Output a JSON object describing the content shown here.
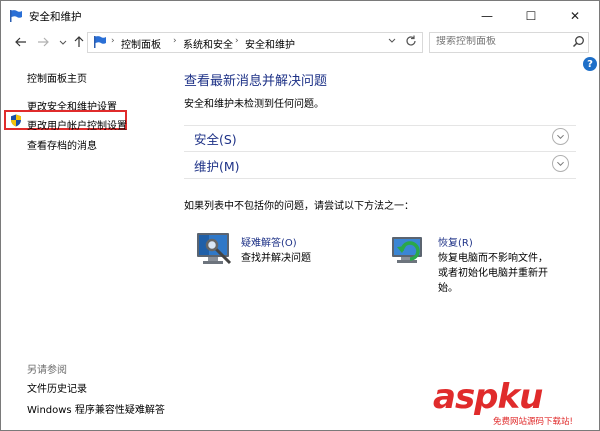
{
  "window": {
    "title": "安全和维护",
    "controls": {
      "minimize": "—",
      "maximize": "☐",
      "close": "✕"
    }
  },
  "address_bar": {
    "breadcrumbs": [
      "控制面板",
      "系统和安全",
      "安全和维护"
    ],
    "separator": "›"
  },
  "search": {
    "placeholder": "搜索控制面板"
  },
  "sidebar": {
    "home": "控制面板主页",
    "items": [
      "更改安全和维护设置",
      "更改用户帐户控制设置",
      "查看存档的消息"
    ],
    "see_also_title": "另请参阅",
    "see_also_items": [
      "文件历史记录",
      "Windows 程序兼容性疑难解答"
    ]
  },
  "main": {
    "title": "查看最新消息并解决问题",
    "subtitle": "安全和维护未检测到任何问题。",
    "sections": [
      {
        "label": "安全(S)"
      },
      {
        "label": "维护(M)"
      }
    ],
    "if_not_listed": "如果列表中不包括你的问题，请尝试以下方法之一：",
    "troubleshoot": {
      "label": "疑难解答(O)",
      "desc": "查找并解决问题"
    },
    "recovery": {
      "label": "恢复(R)",
      "desc_lines": [
        "恢复电脑而不影响文件，",
        "或者初始化电脑并重新开",
        "始。"
      ]
    }
  },
  "help": "?",
  "watermark": {
    "brand": "aspku",
    "tagline": "免费网站源码下载站!"
  },
  "colors": {
    "link": "#1e3287",
    "highlight": "#e02b2b",
    "help": "#1e6fc8"
  }
}
